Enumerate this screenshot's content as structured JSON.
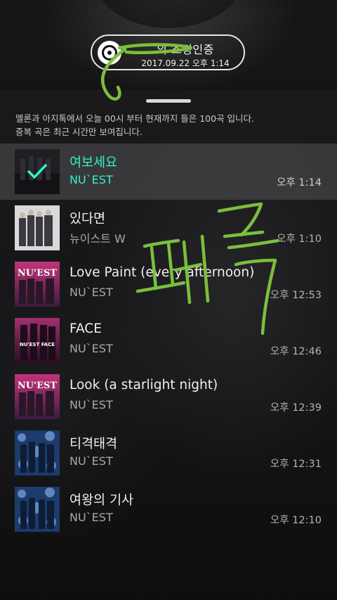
{
  "header": {
    "title": "의 스밍인증",
    "date": "2017.09.22 오후 1:14"
  },
  "notice": {
    "line1": "멜론과 아지톡에서 오늘 00시 부터 현재까지 들은 100곡 입니다.",
    "line2": "중복 곡은 최근 시간만 보여집니다."
  },
  "songs": [
    {
      "title": "여보세요",
      "artist": "NU`EST",
      "time": "오후 1:14",
      "active": true
    },
    {
      "title": "있다면",
      "artist": "뉴이스트 W",
      "time": "오후 1:10"
    },
    {
      "title": "Love Paint (every afternoon)",
      "artist": "NU`EST",
      "time": "오후 12:53",
      "cover_text": "NU'EST"
    },
    {
      "title": "FACE",
      "artist": "NU`EST",
      "time": "오후 12:46",
      "cover_text": "NU'EST FACE"
    },
    {
      "title": "Look (a starlight night)",
      "artist": "NU`EST",
      "time": "오후 12:39",
      "cover_text": "NU'EST"
    },
    {
      "title": "티격태격",
      "artist": "NU`EST",
      "time": "오후 12:31"
    },
    {
      "title": "여왕의 기사",
      "artist": "NU`EST",
      "time": "오후 12:10"
    }
  ],
  "overlay": {
    "handwriting": "팬톡"
  },
  "colors": {
    "accent": "#35f0c9",
    "scribble": "#7bbf3c"
  }
}
